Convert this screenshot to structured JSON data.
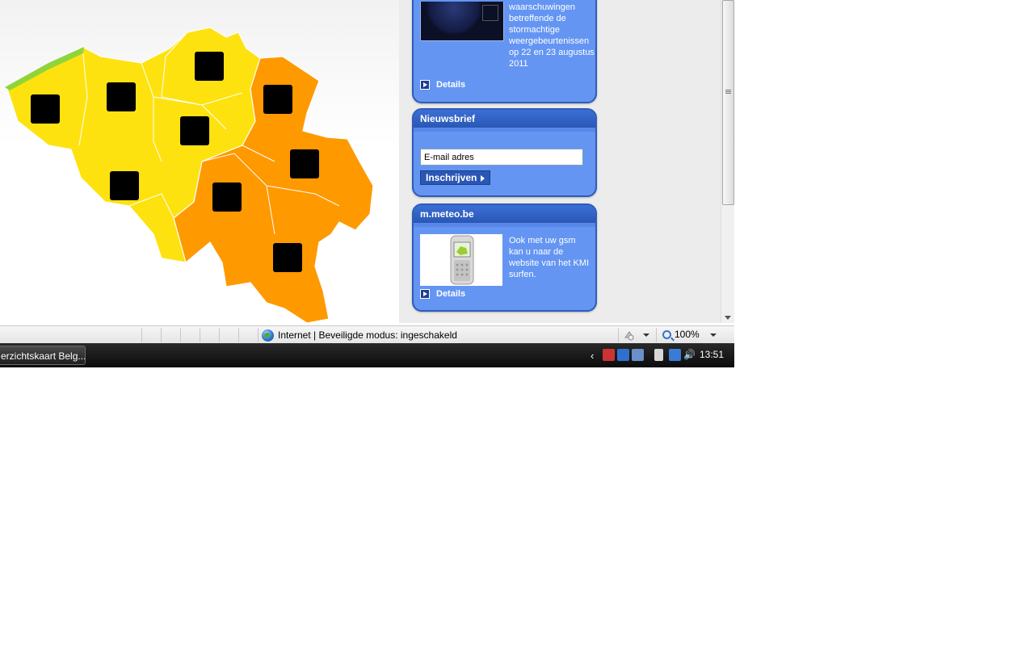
{
  "news_box": {
    "text": "waarschuwingen betreffende de stormachtige weergebeurtenissen op 22 en 23 augustus 2011",
    "details": "Details"
  },
  "newsletter": {
    "title": "Nieuwsbrief",
    "email_value": "E-mail adres",
    "subscribe": "Inschrijven"
  },
  "mobile": {
    "title": "m.meteo.be",
    "text": "Ook met uw gsm kan u naar de website van het KMI surfen.",
    "details": "Details"
  },
  "map": {
    "icons": [
      "thunderstorm-icon",
      "thunderstorm-icon",
      "thunderstorm-icon",
      "thunderstorm-icon",
      "thunderstorm-icon",
      "thunderstorm-icon",
      "thunderstorm-icon",
      "thunderstorm-icon",
      "thunderstorm-icon"
    ],
    "colors": {
      "yellow": "#fde20f",
      "orange": "#ff9900",
      "green": "#8fd53a"
    }
  },
  "statusbar": {
    "zone": "Internet | Beveiligde modus: ingeschakeld",
    "zoom": "100%"
  },
  "taskbar": {
    "window": "erzichtskaart Belg...",
    "clock": "13:51"
  }
}
